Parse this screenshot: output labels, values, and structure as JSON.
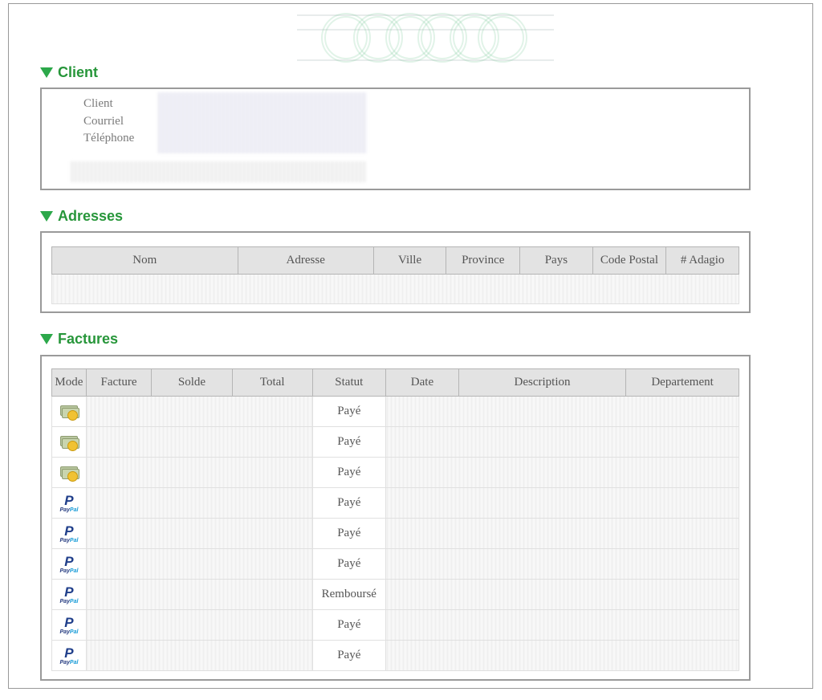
{
  "sections": {
    "client": {
      "title": "Client",
      "labels": [
        "Client",
        "Courriel",
        "Téléphone"
      ]
    },
    "adresses": {
      "title": "Adresses",
      "columns": [
        "Nom",
        "Adresse",
        "Ville",
        "Province",
        "Pays",
        "Code Postal",
        "# Adagio"
      ]
    },
    "factures": {
      "title": "Factures",
      "columns": [
        "Mode",
        "Facture",
        "Solde",
        "Total",
        "Statut",
        "Date",
        "Description",
        "Departement"
      ],
      "rows": [
        {
          "mode_icon": "cash-icon",
          "statut": "Payé"
        },
        {
          "mode_icon": "cash-icon",
          "statut": "Payé"
        },
        {
          "mode_icon": "cash-icon",
          "statut": "Payé"
        },
        {
          "mode_icon": "paypal-icon",
          "statut": "Payé"
        },
        {
          "mode_icon": "paypal-icon",
          "statut": "Payé"
        },
        {
          "mode_icon": "paypal-icon",
          "statut": "Payé"
        },
        {
          "mode_icon": "paypal-icon",
          "statut": "Remboursé"
        },
        {
          "mode_icon": "paypal-icon",
          "statut": "Payé"
        },
        {
          "mode_icon": "paypal-icon",
          "statut": "Payé"
        }
      ]
    }
  },
  "paypal_brand": {
    "letter": "P",
    "word_pay": "Pay",
    "word_pal": "Pal"
  },
  "colors": {
    "section_title": "#27963a",
    "border": "#9a9a9a",
    "header_bg": "#e3e3e3"
  }
}
